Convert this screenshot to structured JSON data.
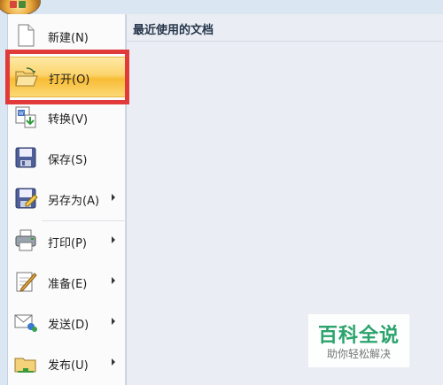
{
  "menu": {
    "items": [
      {
        "label": "新建(N)",
        "icon": "new-document-icon"
      },
      {
        "label": "打开(O)",
        "icon": "open-folder-icon",
        "highlighted": true
      },
      {
        "label": "转换(V)",
        "icon": "convert-icon"
      },
      {
        "label": "保存(S)",
        "icon": "save-icon"
      },
      {
        "label": "另存为(A)",
        "icon": "save-as-icon",
        "submenu": true
      },
      {
        "label": "打印(P)",
        "icon": "print-icon",
        "submenu": true
      },
      {
        "label": "准备(E)",
        "icon": "prepare-icon",
        "submenu": true
      },
      {
        "label": "发送(D)",
        "icon": "send-icon",
        "submenu": true
      },
      {
        "label": "发布(U)",
        "icon": "publish-icon",
        "submenu": true
      }
    ]
  },
  "recent": {
    "title": "最近使用的文档"
  },
  "watermark": {
    "brand": "百科全说",
    "tagline": "助你轻松解决"
  },
  "colors": {
    "highlight": "#f8bc35",
    "annotation_box": "#e03a3a",
    "watermark": "#2aa36c"
  }
}
